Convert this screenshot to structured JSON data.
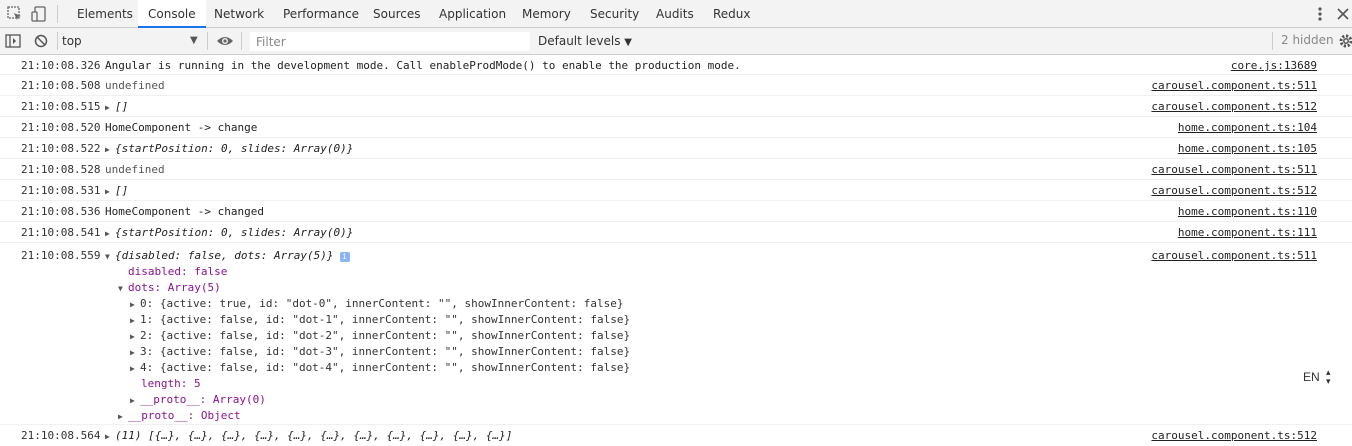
{
  "tabs": [
    "Elements",
    "Console",
    "Network",
    "Performance",
    "Sources",
    "Application",
    "Memory",
    "Security",
    "Audits",
    "Redux"
  ],
  "active_tab": "Console",
  "toolbar": {
    "context": "top",
    "filter_placeholder": "Filter",
    "levels": "Default levels",
    "hidden_count": "2 hidden"
  },
  "logs": [
    {
      "time": "21:10:08.326",
      "text": "Angular is running in the development mode. Call enableProdMode() to enable the production mode.",
      "source": "core.js:13689"
    },
    {
      "time": "21:10:08.508",
      "text": "undefined",
      "source": "carousel.component.ts:511"
    },
    {
      "time": "21:10:08.515",
      "text": "[]",
      "source": "carousel.component.ts:512"
    },
    {
      "time": "21:10:08.520",
      "text": "HomeComponent -> change",
      "source": "home.component.ts:104"
    },
    {
      "time": "21:10:08.522",
      "text": "{startPosition: 0, slides: Array(0)}",
      "source": "home.component.ts:105"
    },
    {
      "time": "21:10:08.528",
      "text": "undefined",
      "source": "carousel.component.ts:511"
    },
    {
      "time": "21:10:08.531",
      "text": "[]",
      "source": "carousel.component.ts:512"
    },
    {
      "time": "21:10:08.536",
      "text": "HomeComponent -> changed",
      "source": "home.component.ts:110"
    },
    {
      "time": "21:10:08.541",
      "text": "{startPosition: 0, slides: Array(0)}",
      "source": "home.component.ts:111"
    },
    {
      "time": "21:10:08.559",
      "text": "{disabled: false, dots: Array(5)}",
      "source": "carousel.component.ts:511"
    },
    {
      "time": "21:10:08.564",
      "text": "(11) [{…}, {…}, {…}, {…}, {…}, {…}, {…}, {…}, {…}, {…}, {…}]",
      "source": "carousel.component.ts:512"
    }
  ],
  "expanded": {
    "disabled": "disabled: false",
    "dots_header": "dots: Array(5)",
    "dots": [
      "0: {active: true, id: \"dot-0\", innerContent: \"\", showInnerContent: false}",
      "1: {active: false, id: \"dot-1\", innerContent: \"\", showInnerContent: false}",
      "2: {active: false, id: \"dot-2\", innerContent: \"\", showInnerContent: false}",
      "3: {active: false, id: \"dot-3\", innerContent: \"\", showInnerContent: false}",
      "4: {active: false, id: \"dot-4\", innerContent: \"\", showInnerContent: false}"
    ],
    "length": "length: 5",
    "proto_array": "__proto__: Array(0)",
    "proto_object": "__proto__: Object"
  },
  "language": "EN",
  "icons": [
    "inspect-icon",
    "device-icon",
    "more-icon",
    "close-icon",
    "sidebar-icon",
    "clear-icon",
    "eye-icon",
    "gear-icon",
    "info-icon"
  ]
}
